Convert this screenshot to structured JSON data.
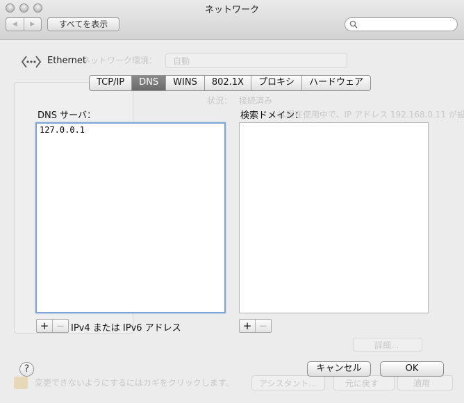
{
  "window": {
    "title": "ネットワーク",
    "show_all": "すべてを表示",
    "search_placeholder": ""
  },
  "background": {
    "location_label": "ネットワーク環境：",
    "location_value": "自動",
    "status_label": "状況：",
    "status_value": "接続済み",
    "status_detail": "は現在使用中で、IP アドレス 192.168.0.11 が設",
    "advanced_button": "詳細...",
    "lock_text": "変更できないようにするにはカギをクリックします。",
    "assistant_button": "アシスタント...",
    "revert_button": "元に戻す",
    "apply_button": "適用"
  },
  "interface": {
    "name": "Ethernet"
  },
  "tabs": [
    {
      "label": "TCP/IP",
      "active": false
    },
    {
      "label": "DNS",
      "active": true
    },
    {
      "label": "WINS",
      "active": false
    },
    {
      "label": "802.1X",
      "active": false
    },
    {
      "label": "プロキシ",
      "active": false
    },
    {
      "label": "ハードウェア",
      "active": false
    }
  ],
  "dns": {
    "label": "DNS サーバ：",
    "servers": [
      "127.0.0.1"
    ],
    "hint": "IPv4 または IPv6 アドレス"
  },
  "search_domains": {
    "label": "検索ドメイン：",
    "domains": []
  },
  "controls": {
    "add": "+",
    "remove": "−"
  },
  "footer": {
    "help": "?",
    "cancel": "キャンセル",
    "ok": "OK"
  }
}
